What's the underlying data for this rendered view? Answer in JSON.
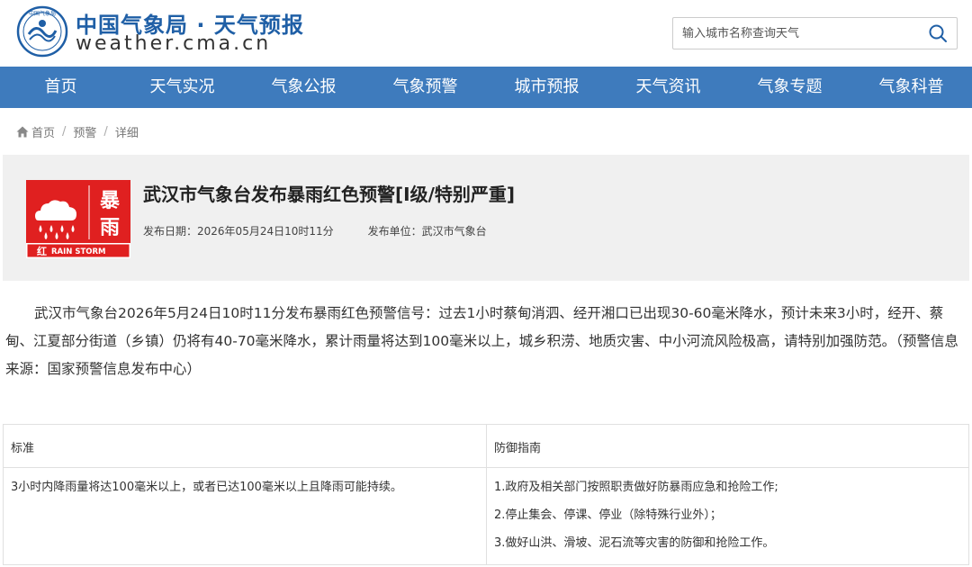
{
  "header": {
    "site_name_cn": "中国气象局 · 天气预报",
    "site_name_en": "weather.cma.cn",
    "emblem_text": "中国气象局",
    "search_placeholder": "输入城市名称查询天气"
  },
  "nav": {
    "items": [
      "首页",
      "天气实况",
      "气象公报",
      "气象预警",
      "城市预报",
      "天气资讯",
      "气象专题",
      "气象科普"
    ]
  },
  "breadcrumb": {
    "home": "首页",
    "items": [
      "预警",
      "详细"
    ],
    "separator": "/"
  },
  "alert": {
    "icon": {
      "label_top": "暴",
      "label_bottom": "雨",
      "level_text": "红",
      "en_text": "RAIN STORM",
      "color": "#e02020"
    },
    "title": "武汉市气象台发布暴雨红色预警[I级/特别严重]",
    "publish_date_label": "发布日期：",
    "publish_date": "2026年05月24日10时11分",
    "publisher_label": "发布单位：",
    "publisher": "武汉市气象台"
  },
  "content": {
    "text": "武汉市气象台2026年5月24日10时11分发布暴雨红色预警信号：过去1小时蔡甸消泗、经开湘口已出现30-60毫米降水，预计未来3小时，经开、蔡甸、江夏部分街道（乡镇）仍将有40-70毫米降水，累计雨量将达到100毫米以上，城乡积涝、地质灾害、中小河流风险极高，请特别加强防范。（预警信息来源：国家预警信息发布中心）"
  },
  "table": {
    "headers": [
      "标准",
      "防御指南"
    ],
    "standard": "3小时内降雨量将达100毫米以上，或者已达100毫米以上且降雨可能持续。",
    "guides": [
      "1.政府及相关部门按照职责做好防暴雨应急和抢险工作;",
      "2.停止集会、停课、停业（除特殊行业外）；",
      "3.做好山洪、滑坡、泥石流等灾害的防御和抢险工作。"
    ]
  },
  "colors": {
    "brand_blue": "#1f5fa6",
    "nav_bg": "#3e7bbd",
    "alert_red": "#e02020",
    "card_bg": "#f0f0f0"
  }
}
